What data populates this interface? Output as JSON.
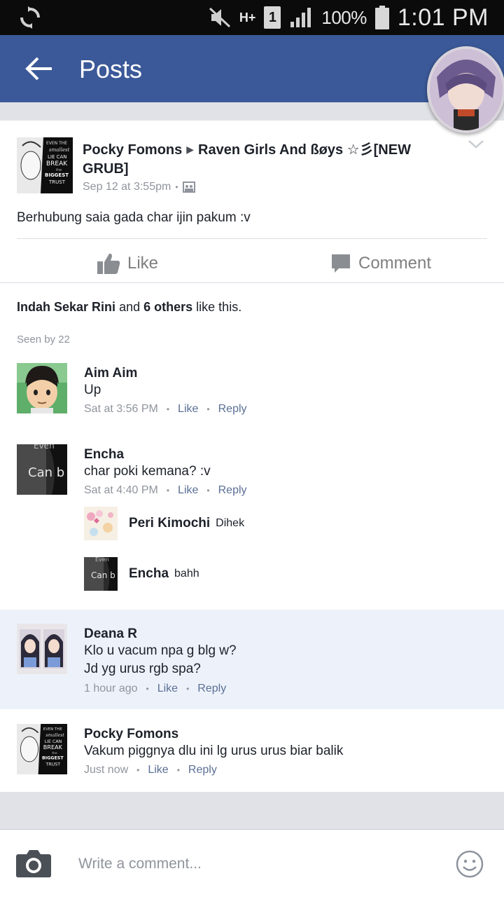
{
  "status_bar": {
    "network": "H+",
    "sim": "1",
    "battery": "100%",
    "time": "1:01 PM",
    "icons": [
      "sync-icon",
      "mute-icon",
      "signal-icon",
      "battery-icon"
    ]
  },
  "app_bar": {
    "title": "Posts",
    "color": "#3b5998"
  },
  "post": {
    "author": "Pocky Fomons",
    "group": "Raven Girls And ßøys ☆彡[NEW GRUB]",
    "timestamp": "Sep 12 at 3:55pm",
    "text": "Berhubung saia gada char ijin pakum :v",
    "like_label": "Like",
    "comment_label": "Comment",
    "avatar_text": [
      "EVEN THE",
      "smallest",
      "LIE CAN",
      "BREAK",
      "the",
      "BIGGEST",
      "TRUST"
    ]
  },
  "likes": {
    "first_name": "Indah Sekar Rini",
    "and": "and",
    "others": "6 others",
    "suffix": "like this.",
    "seen_by": "Seen by 22"
  },
  "comments": [
    {
      "name": "Aim Aim",
      "lines": [
        "Up"
      ],
      "time": "Sat at 3:56 PM",
      "like": "Like",
      "reply": "Reply"
    },
    {
      "name": "Encha",
      "lines": [
        "char poki kemana? :v"
      ],
      "time": "Sat at 4:40 PM",
      "like": "Like",
      "reply": "Reply",
      "avatar_text": [
        "Even",
        "Can b"
      ],
      "replies": [
        {
          "name": "Peri Kimochi",
          "text": "Dihek"
        },
        {
          "name": "Encha",
          "text": "bahh",
          "avatar_text": [
            "Even",
            "Can b"
          ]
        }
      ]
    },
    {
      "name": "Deana R",
      "lines": [
        "Klo u vacum npa g blg w?",
        "Jd yg urus rgb spa?"
      ],
      "time": "1 hour ago",
      "like": "Like",
      "reply": "Reply"
    },
    {
      "name": "Pocky Fomons",
      "lines": [
        "Vakum piggnya dlu ini lg urus urus biar balik"
      ],
      "time": "Just now",
      "like": "Like",
      "reply": "Reply"
    }
  ],
  "composer": {
    "placeholder": "Write a comment..."
  }
}
